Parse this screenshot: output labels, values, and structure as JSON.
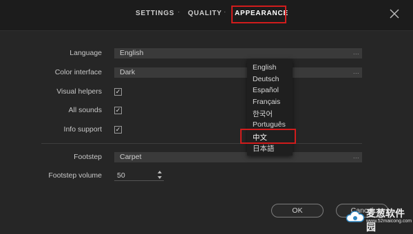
{
  "tabs": {
    "settings": "SETTINGS",
    "quality": "QUALITY",
    "appearance": "APPEARANCE",
    "separator": "·"
  },
  "settings": {
    "language_label": "Language",
    "language_value": "English",
    "color_interface_label": "Color interface",
    "color_interface_value": "Dark",
    "visual_helpers_label": "Visual helpers",
    "all_sounds_label": "All sounds",
    "info_support_label": "Info support",
    "footstep_label": "Footstep",
    "footstep_value": "Carpet",
    "footstep_volume_label": "Footstep volume",
    "footstep_volume_value": "50",
    "ellipsis": "..."
  },
  "checkboxes": {
    "visual_helpers_checked": true,
    "all_sounds_checked": true,
    "info_support_checked": true,
    "check_glyph": "✓"
  },
  "language_dropdown": {
    "options": [
      "English",
      "Deutsch",
      "Español",
      "Français",
      "한국어",
      "Português",
      "中文",
      "日本語"
    ],
    "highlighted": "中文"
  },
  "buttons": {
    "ok": "OK",
    "cancel": "Cancel"
  },
  "watermark": {
    "text": "麦葱软件园",
    "url": "www.52maicong.com"
  },
  "colors": {
    "background": "#262626",
    "topbar": "#1c1c1c",
    "field": "#3a3a3a",
    "highlight": "#d21c1c"
  },
  "icons": {
    "close": "close-icon",
    "stepper": "stepper-arrows-icon",
    "logo": "cloud-logo-icon"
  }
}
